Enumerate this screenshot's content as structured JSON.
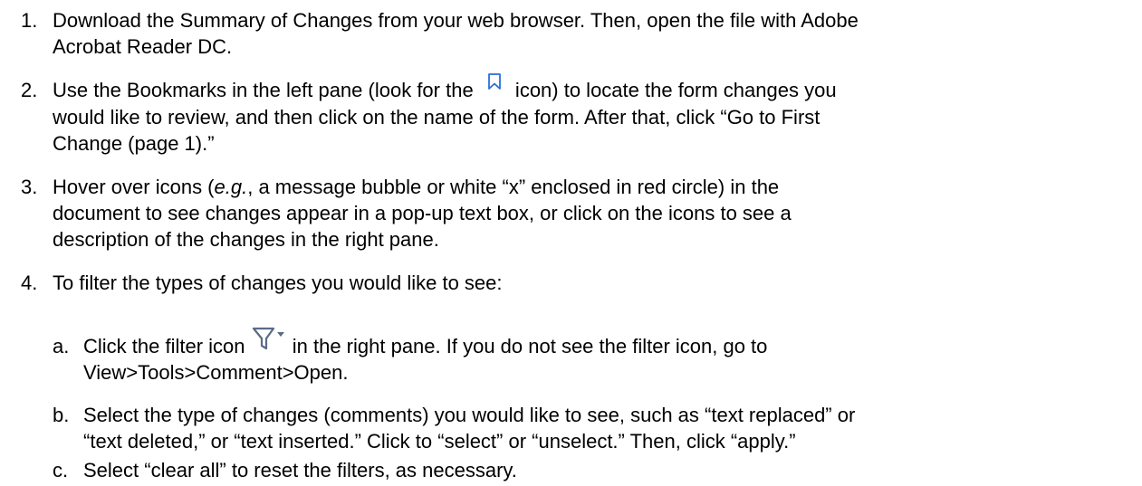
{
  "steps": [
    {
      "number": "1.",
      "lines": [
        "Download the Summary of Changes from your web browser. Then, open the file with Adobe",
        "Acrobat Reader DC."
      ]
    },
    {
      "number": "2.",
      "line1_before_icon": "Use the Bookmarks in the left pane (look for the ",
      "line1_after_icon": " icon) to locate the form changes you",
      "lines": [
        "would like to review, and then click on the name of the form. After that, click “Go to First",
        "Change (page 1).”"
      ]
    },
    {
      "number": "3.",
      "line1_before_em": "Hover over icons (",
      "line1_em": "e.g.",
      "line1_after_em": ", a message bubble or white “x” enclosed in red circle) in the",
      "lines": [
        "document to see changes appear in a pop-up text box, or click on the icons to see a",
        "description of the changes in the right pane."
      ]
    },
    {
      "number": "4.",
      "lines": [
        "To filter the types of changes you would like to see:"
      ]
    }
  ],
  "substeps": [
    {
      "letter": "a.",
      "line1_before_icon": "Click the filter icon ",
      "line1_after_icon": " in the right pane. If you do not see the filter icon, go to",
      "lines": [
        "View>Tools>Comment>Open."
      ]
    },
    {
      "letter": "b.",
      "lines": [
        "Select the type of changes (comments) you would like to see, such as “text replaced” or",
        "“text deleted,” or “text inserted.” Click to “select” or “unselect.”  Then, click “apply.”"
      ]
    },
    {
      "letter": "c.",
      "lines": [
        "Select “clear all” to reset the filters, as necessary."
      ]
    }
  ],
  "icons": {
    "bookmark": "bookmark-icon",
    "filter": "filter-icon",
    "accent_color": "#2b6fd6",
    "filter_color": "#5a6b85"
  }
}
